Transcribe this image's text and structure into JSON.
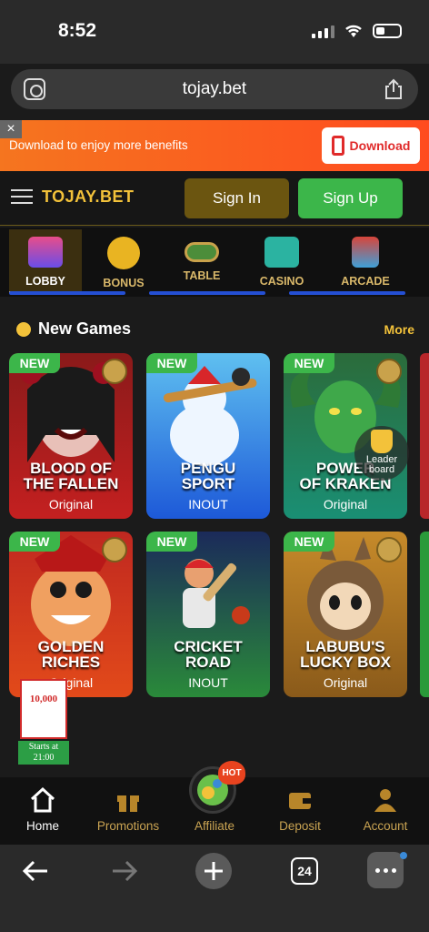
{
  "status_bar": {
    "time": "8:52"
  },
  "browser": {
    "url": "tojay.bet",
    "tab_count": "24"
  },
  "download_banner": {
    "close": "×",
    "text": "Download to enjoy more benefits",
    "button": "Download"
  },
  "header": {
    "logo": "TOJAY.BET",
    "sign_in": "Sign In",
    "sign_up": "Sign Up"
  },
  "categories": [
    {
      "label": "LOBBY",
      "icon": "lobby-icon"
    },
    {
      "label": "BONUS",
      "icon": "bonus-icon"
    },
    {
      "label": "TABLE",
      "icon": "table-icon"
    },
    {
      "label": "CASINO",
      "icon": "casino-icon"
    },
    {
      "label": "ARCADE",
      "icon": "arcade-icon"
    }
  ],
  "section": {
    "title": "New Games",
    "more": "More"
  },
  "games": [
    {
      "tag": "NEW",
      "title_line1": "BLOOD OF",
      "title_line2": "THE FALLEN",
      "provider": "Original"
    },
    {
      "tag": "NEW",
      "title_line1": "PENGU",
      "title_line2": "SPORT",
      "provider": "INOUT"
    },
    {
      "tag": "NEW",
      "title_line1": "POWER",
      "title_line2": "OF KRAKEN",
      "provider": "Original"
    },
    {
      "tag": "NEW",
      "title_line1": "GOLDEN",
      "title_line2": "RICHES",
      "provider": "Original"
    },
    {
      "tag": "NEW",
      "title_line1": "CRICKET",
      "title_line2": "ROAD",
      "provider": "INOUT"
    },
    {
      "tag": "NEW",
      "title_line1": "LABUBU'S",
      "title_line2": "LUCKY BOX",
      "provider": "Original"
    }
  ],
  "leaderboard": {
    "line1": "Leader",
    "line2": "board"
  },
  "ticket": {
    "amount": "10,000",
    "starts_line1": "Starts at",
    "starts_line2": "21:00"
  },
  "bottom_nav": [
    {
      "label": "Home"
    },
    {
      "label": "Promotions"
    },
    {
      "label": "Affiliate"
    },
    {
      "label": "Deposit"
    },
    {
      "label": "Account"
    }
  ],
  "affiliate_hot": "HOT",
  "colors": {
    "accent_gold": "#f3c23a",
    "accent_green": "#3cb64a",
    "banner_orange": "#f5751f"
  }
}
